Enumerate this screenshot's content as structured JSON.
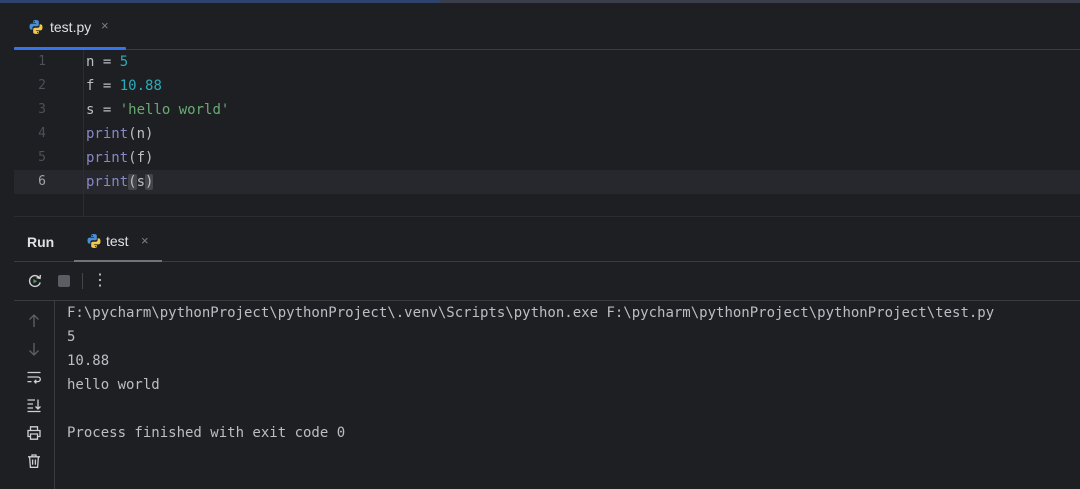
{
  "editor": {
    "tab": {
      "label": "test.py",
      "close": "×"
    },
    "lines": [
      {
        "n": "1",
        "var": "n",
        "op": " = ",
        "val": "5"
      },
      {
        "n": "2",
        "var": "f",
        "op": " = ",
        "val": "10.88"
      },
      {
        "n": "3",
        "var": "s",
        "op": " = ",
        "val": "'hello world'"
      },
      {
        "n": "4",
        "fn": "print",
        "open": "(",
        "arg": "n",
        "close": ")"
      },
      {
        "n": "5",
        "fn": "print",
        "open": "(",
        "arg": "f",
        "close": ")"
      },
      {
        "n": "6",
        "fn": "print",
        "open": "(",
        "arg": "s",
        "close": ")"
      }
    ]
  },
  "run": {
    "title": "Run",
    "tab": {
      "label": "test",
      "close": "×"
    },
    "toolbar": {
      "more": "⋮"
    },
    "output": [
      "F:\\pycharm\\pythonProject\\pythonProject\\.venv\\Scripts\\python.exe F:\\pycharm\\pythonProject\\pythonProject\\test.py",
      "5",
      "10.88",
      "hello world",
      "",
      "Process finished with exit code 0"
    ]
  },
  "icons": {
    "python": "python-logo-icon",
    "rerun": "rerun-icon",
    "stop": "stop-icon",
    "more": "more-vertical-icon",
    "up": "arrow-up-icon",
    "down": "arrow-down-icon",
    "soft_wrap": "soft-wrap-icon",
    "scroll_end": "scroll-to-end-icon",
    "print": "print-icon",
    "clear": "trash-icon"
  },
  "colors": {
    "accent": "#3574f0",
    "number": "#2aacb8",
    "string": "#6aab73",
    "builtin": "#8888c6",
    "text": "#bcbec4"
  }
}
